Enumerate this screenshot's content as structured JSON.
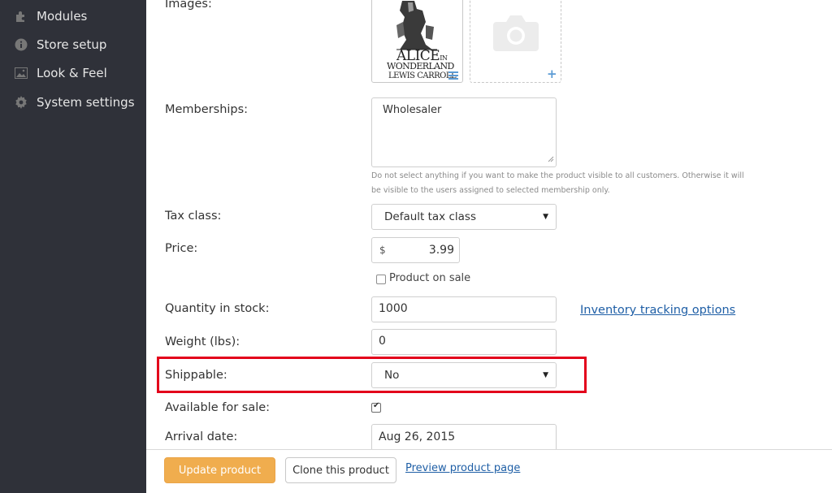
{
  "sidebar": {
    "items": [
      {
        "label": "Modules",
        "icon": "puzzle-icon"
      },
      {
        "label": "Store setup",
        "icon": "info-icon"
      },
      {
        "label": "Look & Feel",
        "icon": "image-icon"
      },
      {
        "label": "System settings",
        "icon": "gear-icon"
      }
    ]
  },
  "form": {
    "images_label": "Images:",
    "book_cover": {
      "line1": "ALICE",
      "line1_small": "IN",
      "line2": "WONDERLAND",
      "line3": "LEWIS CARROLL"
    },
    "memberships_label": "Memberships:",
    "memberships_value": "Wholesaler",
    "memberships_help": "Do not select anything if you want to make the product visible to all customers. Otherwise it will be visible to the users assigned to selected membership only.",
    "tax_class_label": "Tax class:",
    "tax_class_value": "Default tax class",
    "price_label": "Price:",
    "price_currency": "$",
    "price_value": "3.99",
    "product_on_sale_label": "Product on sale",
    "quantity_label": "Quantity in stock:",
    "quantity_value": "1000",
    "inventory_link": "Inventory tracking options",
    "weight_label": "Weight (lbs):",
    "weight_value": "0",
    "shippable_label": "Shippable:",
    "shippable_value": "No",
    "available_label": "Available for sale:",
    "arrival_label": "Arrival date:",
    "arrival_value": "Aug 26, 2015"
  },
  "footer": {
    "update_label": "Update product",
    "clone_label": "Clone this product",
    "preview_label": "Preview product page"
  },
  "colors": {
    "sidebar_bg": "#2f3139",
    "accent_orange": "#f0ad4e",
    "link_blue": "#1f5fa6",
    "highlight_red": "#e3001b"
  }
}
